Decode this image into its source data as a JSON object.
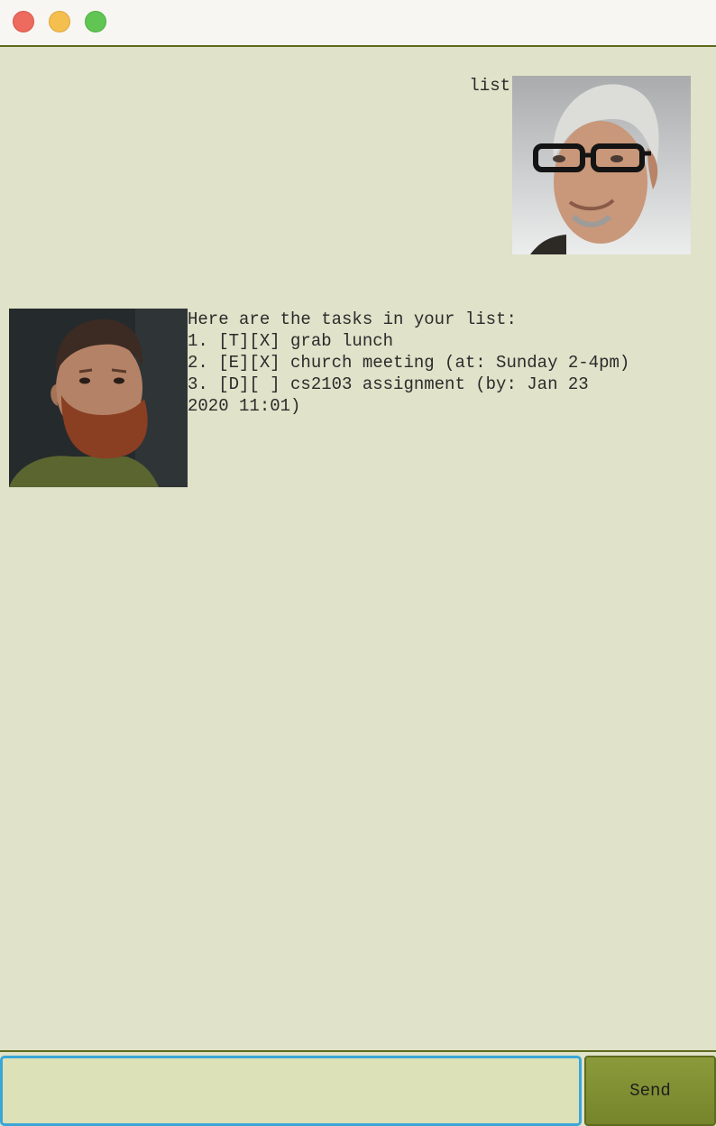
{
  "window": {
    "controls": [
      "close",
      "minimize",
      "maximize"
    ]
  },
  "conversation": {
    "user_message": "list",
    "bot_message": "Here are the tasks in your list:\n1. [T][X] grab lunch\n2. [E][X] church meeting (at: Sunday 2-4pm)\n3. [D][ ] cs2103 assignment (by: Jan 23\n2020 11:01)"
  },
  "input": {
    "value": "",
    "send_label": "Send"
  },
  "colors": {
    "background": "#e0e2c9",
    "accent": "#7f8f32",
    "input_focus": "#3aa6d8"
  }
}
